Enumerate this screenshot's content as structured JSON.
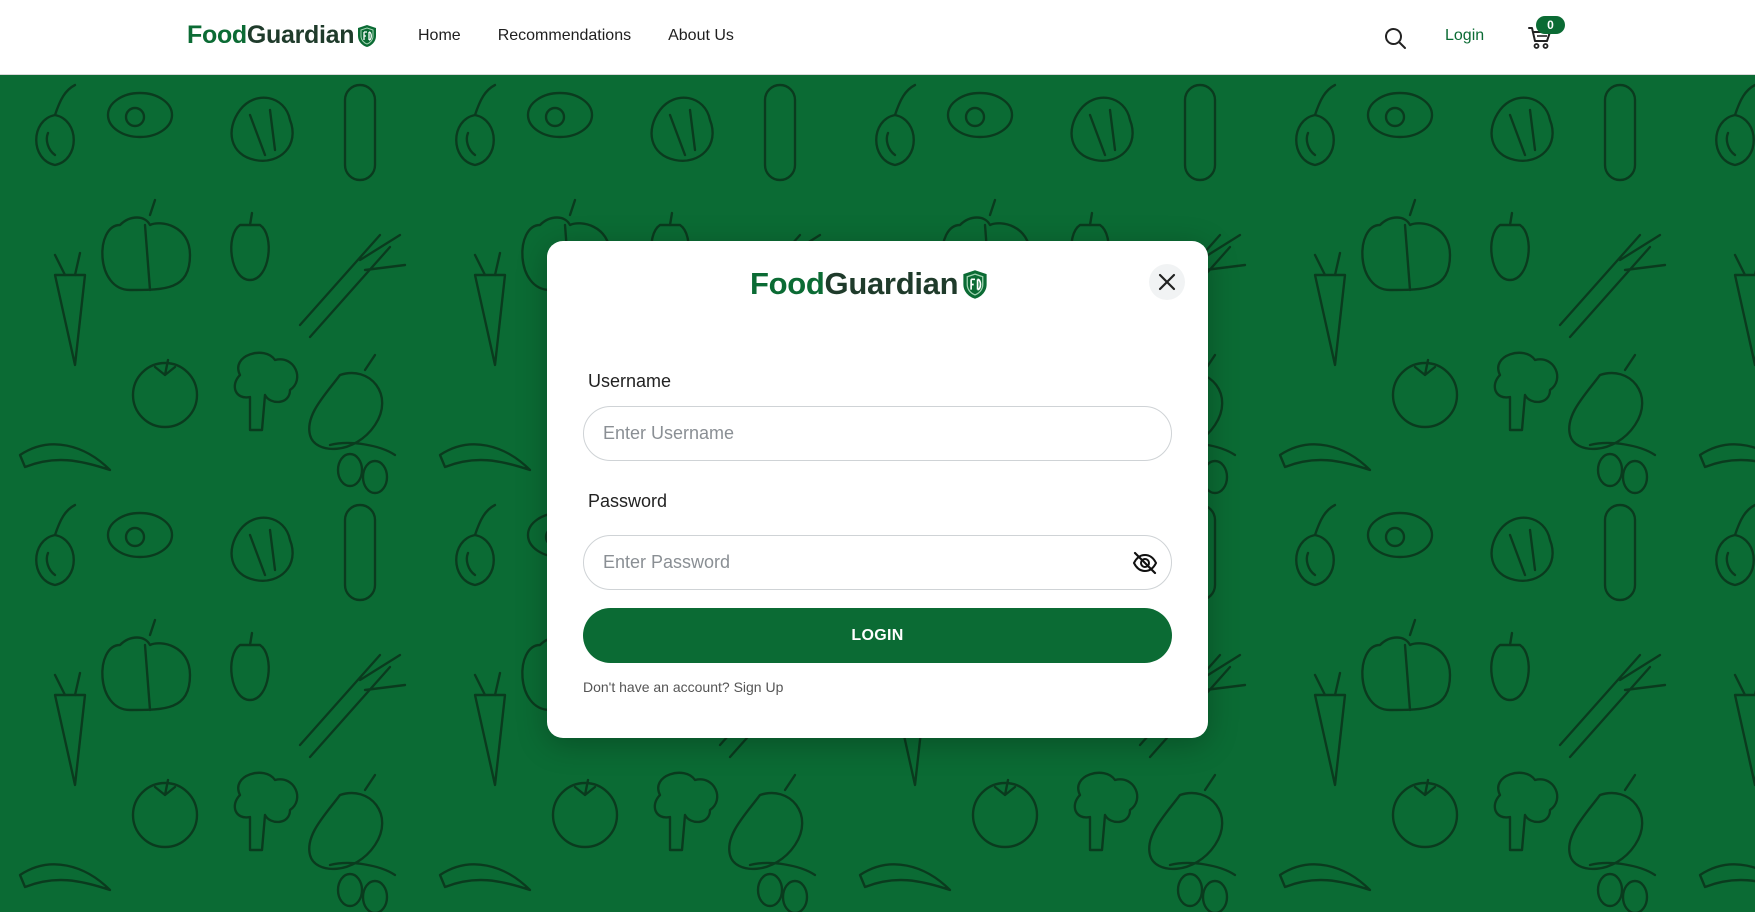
{
  "navbar": {
    "brand_part1": "Food",
    "brand_part2": "Guardian",
    "brand_icon": "shield-logo-icon",
    "links": [
      {
        "label": "Home"
      },
      {
        "label": "Recommendations"
      },
      {
        "label": "About Us"
      }
    ],
    "search_icon": "search-icon",
    "login_label": "Login",
    "cart_icon": "cart-icon",
    "cart_count": "0"
  },
  "hero": {
    "background_color": "#0b6b34",
    "pattern": "vegetable-line-art-pattern"
  },
  "modal": {
    "brand_part1": "Food",
    "brand_part2": "Guardian",
    "close_icon": "close-icon",
    "username_label": "Username",
    "username_placeholder": "Enter Username",
    "username_value": "",
    "password_label": "Password",
    "password_placeholder": "Enter Password",
    "password_value": "",
    "password_toggle_icon": "eye-off-icon",
    "login_button": "LOGIN",
    "signup_prompt": "Don't have an account?",
    "signup_link": "Sign Up"
  },
  "colors": {
    "brand_green": "#0b6b34",
    "brand_dark": "#1f3b2b",
    "text": "#222222"
  }
}
